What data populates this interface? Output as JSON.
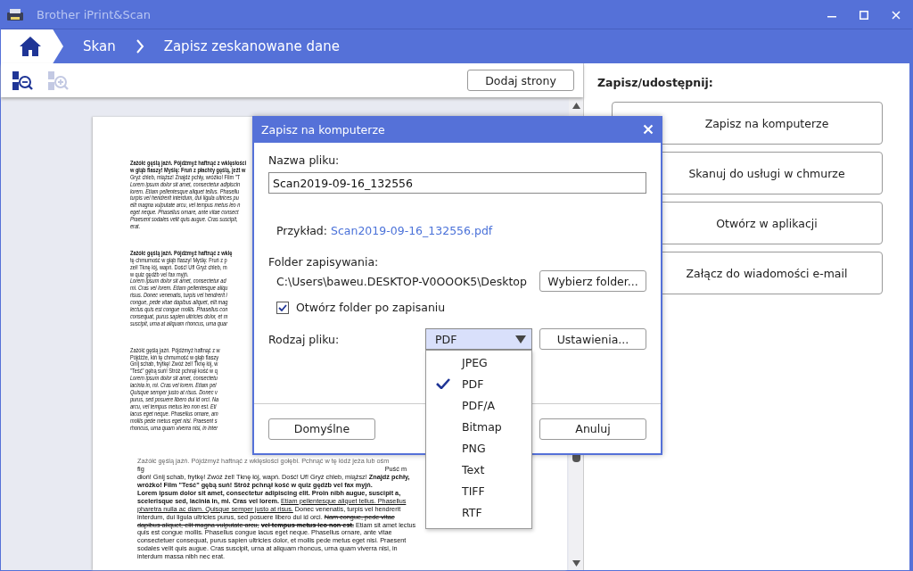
{
  "window": {
    "title": "Brother iPrint&Scan"
  },
  "breadcrumb": [
    {
      "label": "Skan"
    },
    {
      "label": "Zapisz zeskanowane dane"
    }
  ],
  "toolbar": {
    "tools": [
      {
        "kind": "zoom-out",
        "disabled": false
      },
      {
        "kind": "zoom-in",
        "disabled": true
      }
    ],
    "add_pages_button": "Dodaj strony"
  },
  "document": {
    "paragraphs": [
      {
        "kind": "small",
        "lines": [
          {
            "text": "Zażółć gęślą jaźń. Pójdźmyż haftnąć z wklęsłości",
            "kind": "bold"
          },
          {
            "text": "w głąb flaszy! Myślę: Fruń z płachty gęślą, jeżt w",
            "kind": "bold"
          },
          {
            "text": "Gryź chleb, miąższ! Znajdź pchły, wróżko! Film \"T",
            "kind": "normal"
          },
          {
            "text": "Lorem ipsum dolor sit amet, consectetur adipiscin",
            "kind": "italic"
          },
          {
            "text": "lorem. Etiam pellentesque aliquet tellus. Phasellu",
            "kind": "italic"
          },
          {
            "text": "turpis vel hendrerit interdum, dui ligula ultrices pu",
            "kind": "italic"
          },
          {
            "text": "elit magna vulputate arcu, vel tempus metus leo n",
            "kind": "italic"
          },
          {
            "text": "eget neque. Phasellus ornare, ante vitae consect",
            "kind": "italic"
          },
          {
            "text": "Praesent sodales velit quis augue. Cras suscipit,",
            "kind": "italic"
          },
          {
            "text": "erat.",
            "kind": "italic"
          }
        ]
      },
      {
        "kind": "small",
        "lines": [
          {
            "text": "Zażółć gęślą jaźń. Pójdźmyż haftnąć z wklę",
            "kind": "bold"
          },
          {
            "text": "tę chmurność w głąb flaszy! Myślę: Fruń z p",
            "kind": "normal"
          },
          {
            "text": "zeł! Tknę łój, wapń. Dość! Uf! Gryź chleb, m",
            "kind": "normal"
          },
          {
            "text": "w quiz gędźb vel fax myjń.",
            "kind": "normal"
          },
          {
            "text": "Lorem ipsum dolor sit amet, consectetur ad",
            "kind": "italic"
          },
          {
            "text": "mi. Cras vel lorem. Etiam pellentesque aliqu",
            "kind": "italic"
          },
          {
            "text": "risus. Donec venenatis, turpis vel hendrerit i",
            "kind": "italic"
          },
          {
            "text": "congue, pede vitae dapibus aliquet, elit mag",
            "kind": "italic"
          },
          {
            "text": "lectus quis est congue mollis. Phasellus con",
            "kind": "italic"
          },
          {
            "text": "consequat, purus sapien ultricies dolor, et m",
            "kind": "italic"
          },
          {
            "text": "suscipit, urna at aliquam rhoncus, urna quar",
            "kind": "italic"
          }
        ]
      },
      {
        "kind": "small",
        "lines": [
          {
            "text": "Zażółć gęślą jaźń. Pójdźmyż haftnąć z w",
            "kind": "normal"
          },
          {
            "text": "Pójdźże, kiń tę chmurność w głąb flaszy",
            "kind": "normal"
          },
          {
            "text": "Gnij schab, frytkę! Zwóź żel! Tknę łój, w",
            "kind": "normal"
          },
          {
            "text": "\"Teść\" gębą suń! Stróż pchnął kość w q",
            "kind": "normal"
          },
          {
            "text": "Lorem ipsum dolor sit amet, consectetu",
            "kind": "italic"
          },
          {
            "text": "lacinia in, mi. Cras vel lorem. Etiam pel",
            "kind": "italic"
          },
          {
            "text": "Quisque semper justo at risus. Donec v",
            "kind": "italic"
          },
          {
            "text": "purus, sed posuere libero dui id orci. Na",
            "kind": "italic"
          },
          {
            "text": "arcu, vel tempus metus leo non est. Eti",
            "kind": "italic"
          },
          {
            "text": "lacus eget neque. Phasellus ornare, am",
            "kind": "italic"
          },
          {
            "text": "mollis pede metus eget nisi. Praesent s",
            "kind": "italic"
          },
          {
            "text": "rhoncus, urna quam viverra nisi, in inter",
            "kind": "italic"
          }
        ]
      },
      {
        "kind": "large",
        "lines": [
          {
            "text": "Zażółć gęślą jaźń. Pójdźmyż haftnąć z wklęsłości gołębi. Pchnąć w tę łódź jeża lub ośm",
            "kind": "light"
          },
          {
            "segments": [
              {
                "text": "fig",
                "kind": "normal"
              },
              {
                "text": "Puść m",
                "kind": "right"
              }
            ]
          },
          {
            "text": "dłoń! Gnij schab, frytkę! Zwóź żel! Tknę łój, wapń. Dość! Uf! Gryź chleb, miąższ! **Znajdź pchły,**",
            "kind": "normal"
          },
          {
            "text": "wróżko! Film \"Teść\" gębą suń! Stróż pchnął kość w quiz gędźb vel fax myjń.",
            "kind": "bold"
          },
          {
            "text": "Lorem ipsum dolor sit amet, consectetur adipiscing elit. Proin nibh augue, suscipit a,",
            "kind": "bold"
          },
          {
            "segments": [
              {
                "text": "scelerisque sed, lacinia in, mi. Cras vel lorem.",
                "kind": "bold"
              },
              {
                "text": "Etiam pellentesque aliquet tellus. Phasellus",
                "kind": "underline"
              }
            ]
          },
          {
            "segments": [
              {
                "text": "pharetra nulla ac diam. Quisque semper justo at risus.",
                "kind": "underline"
              },
              {
                "text": "Donec venenatis, turpis vel hendrerit",
                "kind": "normal"
              }
            ]
          },
          {
            "segments": [
              {
                "text": "interdum, dui ligula ultricies purus, sed posuere libero dui id orci.",
                "kind": "normal"
              },
              {
                "text": "Nam congue, pede vitae",
                "kind": "strike"
              }
            ]
          },
          {
            "segments": [
              {
                "text": "dapibus aliquet, elit magna vulputate arcu,",
                "kind": "strike"
              },
              {
                "text": "vel tempus metus leo non est.",
                "kind": "strike-bold"
              },
              {
                "text": "Etiam sit amet lectus",
                "kind": "normal"
              }
            ]
          },
          {
            "text": "quis est congue mollis. Phasellus congue lacus eget neque. Phasellus ornare, ante vitae",
            "kind": "normal"
          },
          {
            "text": "consectetuer consequat, purus sapien ultricies dolor, et mollis pede metus eget nisi. Praesent",
            "kind": "normal"
          },
          {
            "text": "sodales velit quis augue. Cras suscipit, urna at aliquam rhoncus, urna quam viverra nisi, in",
            "kind": "normal"
          },
          {
            "text": "interdum massa nibh nec erat.",
            "kind": "normal"
          }
        ]
      }
    ]
  },
  "share_panel": {
    "title": "Zapisz/udostępnij:",
    "actions": [
      "Zapisz na komputerze",
      "Skanuj do usługi w chmurze",
      "Otwórz w aplikacji",
      "Załącz do wiadomości e-mail"
    ]
  },
  "dialog": {
    "title": "Zapisz na komputerze",
    "file_name": {
      "label": "Nazwa pliku:",
      "value": "Scan2019-09-16_132556"
    },
    "example": {
      "label": "Przykład:",
      "value": "Scan2019-09-16_132556.pdf"
    },
    "folder": {
      "label": "Folder zapisywania:",
      "path": "C:\\Users\\baweu.DESKTOP-V0OOOK5\\Desktop",
      "button": "Wybierz folder..."
    },
    "open_folder": {
      "label": "Otwórz folder po zapisaniu",
      "checked": true
    },
    "file_type": {
      "label": "Rodzaj pliku:",
      "value": "PDF",
      "expanded": true,
      "button": "Ustawienia...",
      "options": [
        {
          "label": "JPEG",
          "selected": false
        },
        {
          "label": "PDF",
          "selected": true
        },
        {
          "label": "PDF/A",
          "selected": false
        },
        {
          "label": "Bitmap",
          "selected": false
        },
        {
          "label": "PNG",
          "selected": false
        },
        {
          "label": "Text",
          "selected": false
        },
        {
          "label": "TIFF",
          "selected": false
        },
        {
          "label": "RTF",
          "selected": false
        }
      ]
    },
    "buttons": [
      {
        "label": "Domyślne"
      },
      {
        "label": "Anuluj"
      }
    ]
  }
}
